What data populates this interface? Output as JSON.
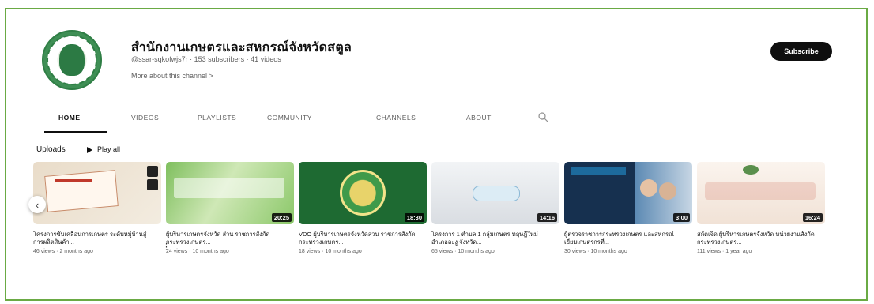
{
  "top_glyph": "ู",
  "channel": {
    "title": "สำนักงานเกษตรและสหกรณ์จังหวัดสตูล",
    "meta": "@ssar-sqkofwjs7r · 153 subscribers · 41 videos",
    "more": "More about this channel  >",
    "subscribe_label": "Subscribe"
  },
  "tabs": [
    {
      "label": "HOME"
    },
    {
      "label": "VIDEOS"
    },
    {
      "label": "PLAYLISTS"
    },
    {
      "label": "COMMUNITY"
    },
    {
      "label": "CHANNELS"
    },
    {
      "label": "ABOUT"
    }
  ],
  "uploads": {
    "label": "Uploads",
    "play_all": "Play all"
  },
  "videos": [
    {
      "title": "โครงการขับเคลื่อนการเกษตร ระดับหมู่บ้านสู่การผลิตสินค้า...",
      "meta": "46 views · 2 months ago",
      "duration": ""
    },
    {
      "title": "ผู้บริหารเกษตรจังหวัด ส่วน ราชการสังกัดกระทรวงเกษตร...",
      "meta": "24 views · 10 months ago",
      "duration": "20:25"
    },
    {
      "title": "VDO ผู้บริหารเกษตรจังหวัดส่วน ราชการสังกัดกระทรวงเกษตร...",
      "meta": "18 views · 10 months ago",
      "duration": "18:30"
    },
    {
      "title": "โครงการ 1 ตำบล 1 กลุ่มเกษตร ทฤษฎีใหม่ อำเภอละงู จังหวัด...",
      "meta": "65 views · 10 months ago",
      "duration": "14:16"
    },
    {
      "title": "ผู้ตรวจราชการกระทรวงเกษตร และสหกรณ์ เยี่ยมเกษตรกรที่...",
      "meta": "30 views · 10 months ago",
      "duration": "3:00"
    },
    {
      "title": "สกัดเจ็ด ผู้บริหารเกษตรจังหวัด หน่วยงานสังกัดกระทรวงเกษตร...",
      "meta": "111 views · 1 year ago",
      "duration": "16:24"
    }
  ],
  "colors": {
    "frame_border": "#6aaa44",
    "subscribe_bg": "#0f0f0f"
  }
}
